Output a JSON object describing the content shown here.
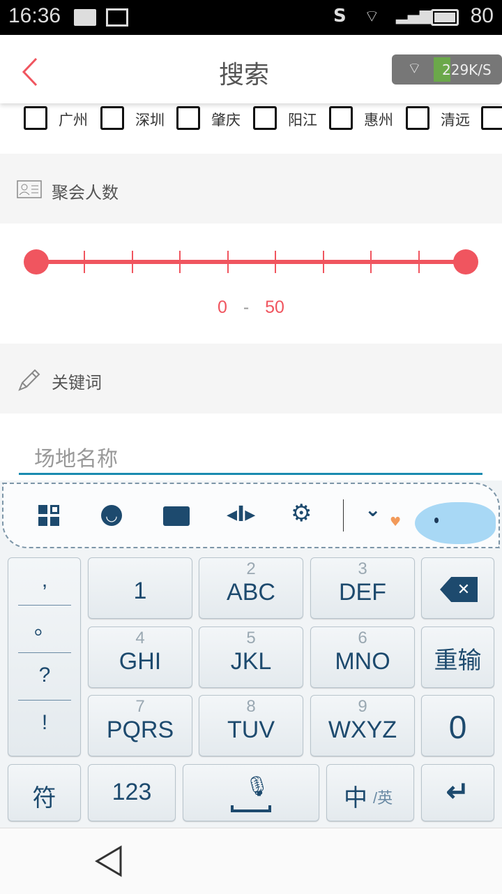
{
  "status_bar": {
    "time": "16:36",
    "battery": "80"
  },
  "header": {
    "title": "搜索",
    "net_speed": "229K/S"
  },
  "cities": [
    "广州",
    "深圳",
    "肇庆",
    "阳江",
    "惠州",
    "清远"
  ],
  "group_size": {
    "label": "聚会人数",
    "min": "0",
    "sep": "-",
    "max": "50",
    "range_min": 0,
    "range_max": 50,
    "ticks": 8
  },
  "keyword": {
    "label": "关键词",
    "placeholder": "场地名称",
    "value": ""
  },
  "keyboard": {
    "punct": [
      ",",
      "。",
      "?",
      "!"
    ],
    "keys": [
      {
        "num": "",
        "main": "1"
      },
      {
        "num": "2",
        "main": "ABC"
      },
      {
        "num": "3",
        "main": "DEF"
      },
      {
        "num": "4",
        "main": "GHI"
      },
      {
        "num": "5",
        "main": "JKL"
      },
      {
        "num": "6",
        "main": "MNO"
      },
      {
        "num": "7",
        "main": "PQRS"
      },
      {
        "num": "8",
        "main": "TUV"
      },
      {
        "num": "9",
        "main": "WXYZ"
      }
    ],
    "reinput": "重输",
    "zero": "0",
    "symbol": "符",
    "num_mode": "123",
    "lang_main": "中",
    "lang_sub": "/英",
    "accent": "#1d4a6e"
  },
  "colors": {
    "accent": "#f0555f",
    "underline": "#1a8bb0"
  }
}
